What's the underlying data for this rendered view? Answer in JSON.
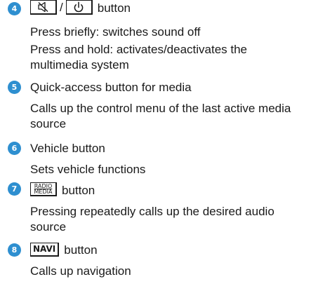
{
  "items": [
    {
      "number": "4",
      "keys": {
        "mute_icon": "mute-icon",
        "separator": "/",
        "power_icon": "power-icon"
      },
      "title": "button",
      "descriptions": [
        "Press briefly: switches sound off",
        "Press and hold: activates/deactivates the multimedia system"
      ]
    },
    {
      "number": "5",
      "title": "Quick-access button for media",
      "descriptions": [
        "Calls up the control menu of the last active media source"
      ]
    },
    {
      "number": "6",
      "title": "Vehicle button",
      "descriptions": [
        "Sets vehicle functions"
      ]
    },
    {
      "number": "7",
      "keys": {
        "radio_line1": "RADIO",
        "radio_line2": "MEDIA"
      },
      "title": "button",
      "descriptions": [
        "Pressing repeatedly calls up the desired audio source"
      ]
    },
    {
      "number": "8",
      "keys": {
        "navi": "NAVI"
      },
      "title": "button",
      "descriptions": [
        "Calls up navigation"
      ]
    }
  ],
  "colors": {
    "number_badge": "#2e8fd0",
    "text": "#1a1a1a"
  }
}
